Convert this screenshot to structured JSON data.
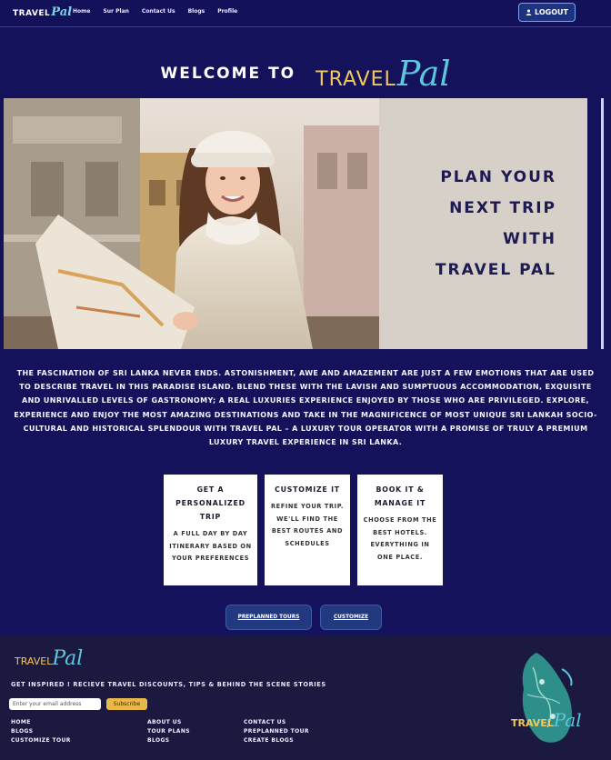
{
  "nav": {
    "logo_a": "TRAVEL",
    "logo_b": "Pal",
    "links": [
      "Home",
      "Sur Plan",
      "Contact Us",
      "Blogs",
      "Profile"
    ],
    "logout_label": "LOGOUT",
    "logout_icon": "user-icon"
  },
  "hero": {
    "welcome": "WELCOME TO",
    "brand_a": "TRAVEL",
    "brand_b": "Pal",
    "panel_lines": [
      "PLAN YOUR",
      "NEXT TRIP",
      "WITH",
      "TRAVEL PAL"
    ]
  },
  "intro": "THE FASCINATION OF SRI LANKA NEVER ENDS. ASTONISHMENT, AWE AND AMAZEMENT ARE JUST A FEW EMOTIONS THAT ARE USED TO DESCRIBE TRAVEL IN THIS PARADISE ISLAND. BLEND THESE WITH THE LAVISH AND SUMPTUOUS ACCOMMODATION, EXQUISITE AND UNRIVALLED LEVELS OF GASTRONOMY; A REAL LUXURIES EXPERIENCE ENJOYED BY THOSE WHO ARE PRIVILEGED. EXPLORE, EXPERIENCE AND ENJOY THE MOST AMAZING DESTINATIONS AND TAKE IN THE MAGNIFICENCE OF MOST UNIQUE SRI LANKAH SOCIO-CULTURAL AND HISTORICAL SPLENDOUR WITH TRAVEL PAL – A LUXURY TOUR OPERATOR WITH A PROMISE OF TRULY A PREMIUM LUXURY TRAVEL EXPERIENCE IN SRI LANKA.",
  "cards": [
    {
      "title": "GET A PERSONALIZED TRIP",
      "body": "A FULL DAY BY DAY ITINERARY BASED ON YOUR PREFERENCES"
    },
    {
      "title": "CUSTOMIZE IT",
      "body": "REFINE YOUR TRIP. WE'LL FIND THE BEST ROUTES AND SCHEDULES"
    },
    {
      "title": "BOOK IT & MANAGE IT",
      "body": "CHOOSE FROM THE BEST HOTELS. EVERYTHING IN ONE PLACE."
    }
  ],
  "buttons": {
    "preplanned": "PREPLANNED TOURS",
    "customize": "CUSTOMIZE"
  },
  "footer": {
    "logo_a": "TRAVEL",
    "logo_b": "Pal",
    "tagline": "GET INSPIRED ! RECIEVE TRAVEL DISCOUNTS, TIPS & BEHIND THE SCENE STORIES",
    "email_placeholder": "Enter your email address",
    "subscribe_label": "Subscribe",
    "col1": [
      "HOME",
      "BLOGS",
      "CUSTOMIZE TOUR"
    ],
    "col2": [
      "ABOUT US",
      "TOUR PLANS",
      "BLOGS"
    ],
    "col3": [
      "CONTACT US",
      "PREPLANNED TOUR",
      "CREATE BLOGS"
    ],
    "map_logo_a": "TRAVEL",
    "map_logo_b": "Pal",
    "colors": {
      "gold": "#f2c85b",
      "teal": "#5cc7df",
      "navy": "#14125a"
    }
  }
}
